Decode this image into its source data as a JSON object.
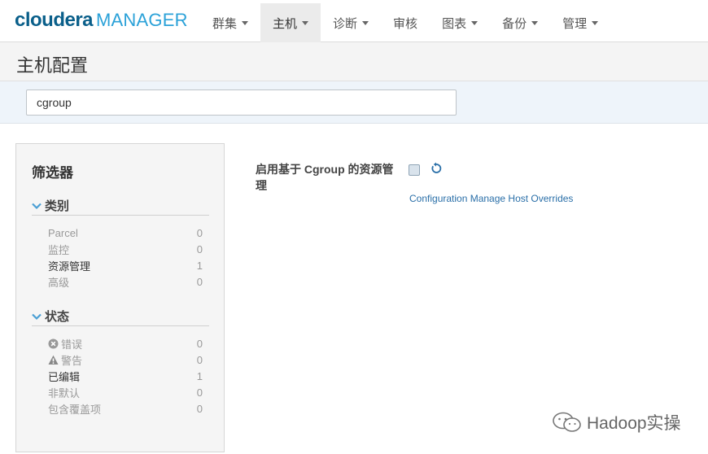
{
  "navbar": {
    "logo_cloudera": "cloudera",
    "logo_manager": "MANAGER",
    "items": [
      {
        "label": "群集",
        "dropdown": true,
        "active": false
      },
      {
        "label": "主机",
        "dropdown": true,
        "active": true
      },
      {
        "label": "诊断",
        "dropdown": true,
        "active": false
      },
      {
        "label": "审核",
        "dropdown": false,
        "active": false
      },
      {
        "label": "图表",
        "dropdown": true,
        "active": false
      },
      {
        "label": "备份",
        "dropdown": true,
        "active": false
      },
      {
        "label": "管理",
        "dropdown": true,
        "active": false
      }
    ]
  },
  "page": {
    "title": "主机配置"
  },
  "search": {
    "value": "cgroup"
  },
  "filter": {
    "title": "筛选器",
    "category": {
      "label": "类别",
      "items": [
        {
          "name": "Parcel",
          "count": "0"
        },
        {
          "name": "监控",
          "count": "0"
        },
        {
          "name": "资源管理",
          "count": "1"
        },
        {
          "name": "高级",
          "count": "0"
        }
      ]
    },
    "status": {
      "label": "状态",
      "items": [
        {
          "name": "错误",
          "count": "0",
          "icon": "error-circle-icon"
        },
        {
          "name": "警告",
          "count": "0",
          "icon": "warning-triangle-icon"
        },
        {
          "name": "已编辑",
          "count": "1"
        },
        {
          "name": "非默认",
          "count": "0"
        },
        {
          "name": "包含覆盖项",
          "count": "0"
        }
      ]
    }
  },
  "config": {
    "label": "启用基于 Cgroup 的资源管理",
    "checked": false,
    "link": "Configuration Manage Host Overrides"
  },
  "watermark": {
    "text": "Hadoop实操"
  },
  "colors": {
    "brand_dark": "#0a5f8a",
    "brand_light": "#2aa1d8",
    "link": "#2a6fa8",
    "chevron": "#4a9fd4"
  }
}
